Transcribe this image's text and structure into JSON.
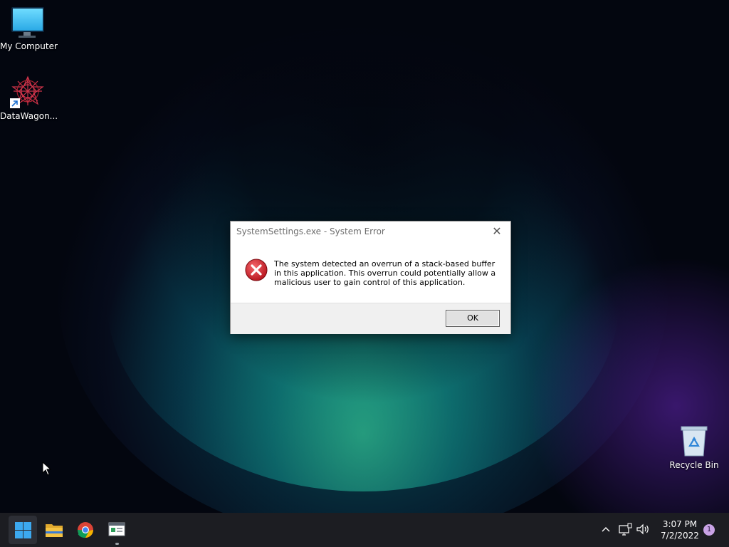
{
  "desktop": {
    "icons": [
      {
        "label": "My Computer",
        "icon": "monitor-icon"
      },
      {
        "label": "DataWagon...",
        "icon": "datawagon-shortcut-icon"
      },
      {
        "label": "Recycle Bin",
        "icon": "recycle-bin-icon"
      }
    ]
  },
  "dialog": {
    "title": "SystemSettings.exe - System Error",
    "close_glyph": "✕",
    "icon": "error-icon",
    "message": "The system detected an overrun of a stack-based buffer in this application. This overrun could potentially allow a malicious user to gain control of this application.",
    "ok_label": "OK"
  },
  "taskbar": {
    "apps": [
      {
        "name": "start",
        "icon": "windows-start-icon"
      },
      {
        "name": "file-explorer",
        "icon": "folder-icon"
      },
      {
        "name": "chrome",
        "icon": "chrome-icon"
      },
      {
        "name": "settings-app",
        "icon": "app-window-icon"
      }
    ],
    "tray": {
      "chevron": "^",
      "time": "3:07 PM",
      "date": "7/2/2022",
      "notification_count": "1"
    }
  },
  "colors": {
    "error_red": "#d8262f",
    "start_blue": "#3ca9f0",
    "taskbar_bg": "#1c1d22",
    "folder_yellow": "#f5c342"
  }
}
